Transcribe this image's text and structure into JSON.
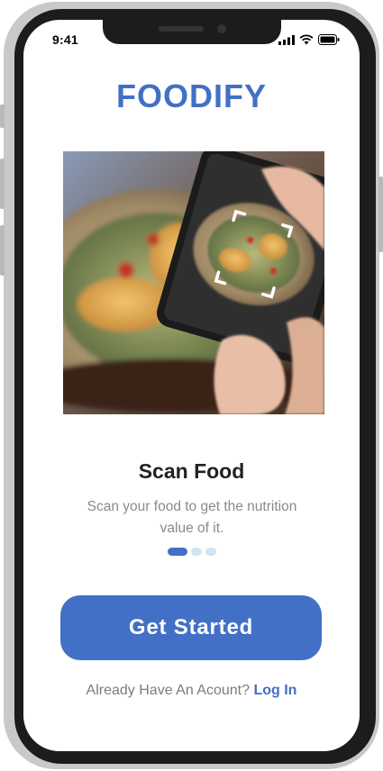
{
  "status_bar": {
    "time": "9:41",
    "icons": [
      "signal-icon",
      "wifi-icon",
      "battery-icon"
    ]
  },
  "app": {
    "title": "FOODIFY",
    "brand_color": "#4270c6"
  },
  "hero": {
    "image": "photo-of-phone-scanning-food-bowl",
    "scan_frame_icon": "scan-frame-icon"
  },
  "onboarding": {
    "heading": "Scan Food",
    "description": "Scan your food to get the nutrition value of it.",
    "page_indicator": {
      "total": 3,
      "active": 1
    }
  },
  "cta": {
    "label": "Get Started"
  },
  "login": {
    "prompt": "Already Have An Acount?",
    "link": "Log In"
  }
}
